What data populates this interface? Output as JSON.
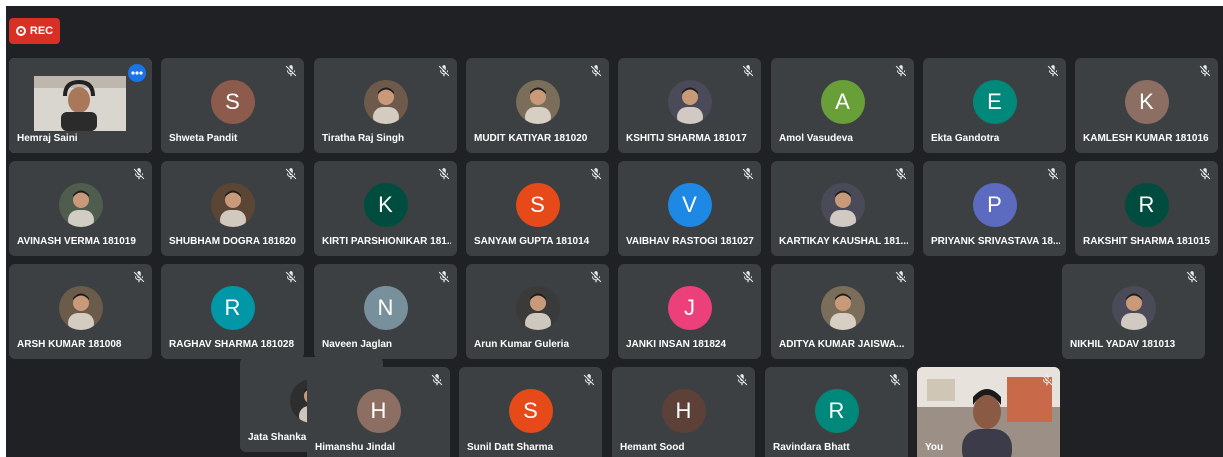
{
  "recording": {
    "label": "REC"
  },
  "colors": {
    "background": "#202124",
    "tile": "#3c4043",
    "rec": "#d93025",
    "speaking_outline": "#8ab4f8"
  },
  "participants": [
    {
      "name": "Hemraj Saini",
      "muted": false,
      "speaking": true,
      "video": true
    },
    {
      "name": "Shweta Pandit",
      "initial": "S",
      "color": "#8d5b4b",
      "muted": true
    },
    {
      "name": "Tiratha Raj Singh",
      "photo": true,
      "muted": true
    },
    {
      "name": "MUDIT KATIYAR 181020",
      "photo": true,
      "muted": true
    },
    {
      "name": "KSHITIJ SHARMA 181017",
      "photo": true,
      "muted": true
    },
    {
      "name": "Amol Vasudeva",
      "initial": "A",
      "color": "#689f38",
      "muted": true
    },
    {
      "name": "Ekta Gandotra",
      "initial": "E",
      "color": "#00897b",
      "muted": true
    },
    {
      "name": "KAMLESH KUMAR 181016",
      "initial": "K",
      "color": "#8d6e63",
      "muted": true
    },
    {
      "name": "AVINASH VERMA 181019",
      "photo": true,
      "muted": true
    },
    {
      "name": "SHUBHAM DOGRA 181820",
      "photo": true,
      "muted": true
    },
    {
      "name": "KIRTI PARSHIONIKAR 181...",
      "initial": "K",
      "color": "#004d40",
      "muted": true
    },
    {
      "name": "SANYAM GUPTA 181014",
      "initial": "S",
      "color": "#e64a19",
      "muted": true
    },
    {
      "name": "VAIBHAV RASTOGI 181027",
      "initial": "V",
      "color": "#1e88e5",
      "muted": true
    },
    {
      "name": "KARTIKAY KAUSHAL 181...",
      "photo": true,
      "muted": true
    },
    {
      "name": "PRIYANK SRIVASTAVA 18...",
      "initial": "P",
      "color": "#5c6bc0",
      "muted": true
    },
    {
      "name": "RAKSHIT SHARMA 181015",
      "initial": "R",
      "color": "#004d40",
      "muted": true
    },
    {
      "name": "ARSH KUMAR 181008",
      "photo": true,
      "muted": true
    },
    {
      "name": "RAGHAV SHARMA 181028",
      "initial": "R",
      "color": "#0097a7",
      "muted": true
    },
    {
      "name": "Naveen Jaglan",
      "initial": "N",
      "color": "#78909c",
      "muted": true
    },
    {
      "name": "Arun Kumar Guleria",
      "photo": true,
      "muted": true
    },
    {
      "name": "JANKI INSAN 181824",
      "initial": "J",
      "color": "#ec407a",
      "muted": true
    },
    {
      "name": "ADITYA KUMAR JAISWA...",
      "photo": true,
      "muted": true
    },
    {
      "name": "NIKHIL YADAV 181013",
      "photo": true,
      "muted": true
    },
    {
      "name": "Jata Shanka",
      "photo": true,
      "muted": false
    },
    {
      "name": "Himanshu Jindal",
      "initial": "H",
      "color": "#8d6e63",
      "muted": true
    },
    {
      "name": "Sunil Datt Sharma",
      "initial": "S",
      "color": "#e64a19",
      "muted": true
    },
    {
      "name": "Hemant Sood",
      "initial": "H",
      "color": "#5d4037",
      "muted": true
    },
    {
      "name": "Ravindara Bhatt",
      "initial": "R",
      "color": "#00897b",
      "muted": true
    },
    {
      "name": "You",
      "muted": true,
      "video": true,
      "self": true
    }
  ]
}
